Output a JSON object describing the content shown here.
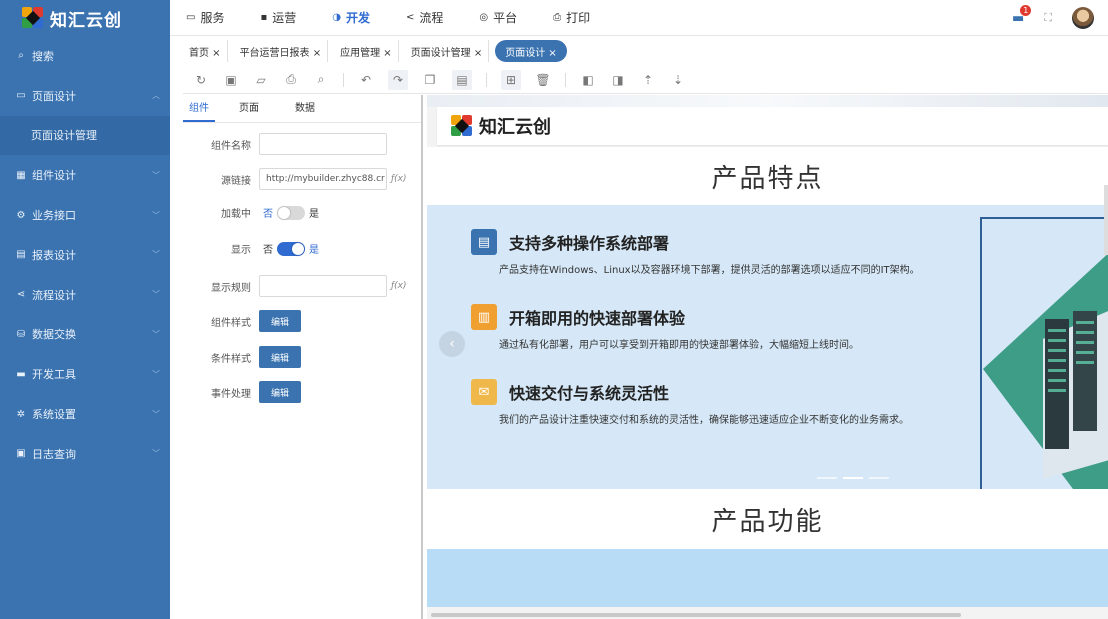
{
  "app": {
    "name": "知汇云创"
  },
  "sidebar": {
    "items": [
      {
        "label": "搜索",
        "icon": "search-icon",
        "glyph": "⌕"
      },
      {
        "label": "页面设计",
        "icon": "window-icon",
        "glyph": "▭",
        "expanded": true
      },
      {
        "label": "页面设计管理",
        "sub": true
      },
      {
        "label": "组件设计",
        "icon": "grid-icon",
        "glyph": "▦"
      },
      {
        "label": "业务接口",
        "icon": "plug-icon",
        "glyph": "⚙"
      },
      {
        "label": "报表设计",
        "icon": "clipboard-icon",
        "glyph": "▤"
      },
      {
        "label": "流程设计",
        "icon": "share-icon",
        "glyph": "⋖"
      },
      {
        "label": "数据交换",
        "icon": "database-icon",
        "glyph": "⛁"
      },
      {
        "label": "开发工具",
        "icon": "toolbox-icon",
        "glyph": "▬"
      },
      {
        "label": "系统设置",
        "icon": "gear-icon",
        "glyph": "✲"
      },
      {
        "label": "日志查询",
        "icon": "log-icon",
        "glyph": "▣"
      }
    ]
  },
  "topnav": {
    "items": [
      {
        "label": "服务",
        "glyph": "▭"
      },
      {
        "label": "运营",
        "glyph": "▪"
      },
      {
        "label": "开发",
        "glyph": "◑",
        "active": true
      },
      {
        "label": "流程",
        "glyph": "<"
      },
      {
        "label": "平台",
        "glyph": "◎"
      },
      {
        "label": "打印",
        "glyph": "⎙"
      }
    ],
    "notification_count": "1"
  },
  "tabs": [
    {
      "label": "首页 ×"
    },
    {
      "label": "平台运营日报表 ×"
    },
    {
      "label": "应用管理 ×"
    },
    {
      "label": "页面设计管理 ×"
    },
    {
      "label": "页面设计 ×",
      "active": true
    }
  ],
  "panel": {
    "tabs": [
      "组件",
      "页面",
      "数据"
    ],
    "fields": {
      "name_label": "组件名称",
      "name_value": "",
      "link_label": "源链接",
      "link_value": "http://mybuilder.zhyc88.cr",
      "fx": "ƒ(x)",
      "loading_label": "加载中",
      "loading_no": "否",
      "loading_yes": "是",
      "loading_on": false,
      "show_label": "显示",
      "show_no": "否",
      "show_yes": "是",
      "show_on": true,
      "rule_label": "显示规则",
      "rule_value": "",
      "style_label": "组件样式",
      "cond_label": "条件样式",
      "event_label": "事件处理",
      "edit": "编辑"
    }
  },
  "canvas": {
    "brand": "知汇云创",
    "section1_title": "产品特点",
    "features": [
      {
        "title": "支持多种操作系统部署",
        "desc": "产品支持在Windows、Linux以及容器环境下部署，提供灵活的部署选项以适应不同的IT架构。",
        "color": "#3a73b0",
        "icon": "chat-icon",
        "glyph": "▤"
      },
      {
        "title": "开箱即用的快速部署体验",
        "desc": "通过私有化部署，用户可以享受到开箱即用的快速部署体验，大幅缩短上线时间。",
        "color": "#f0a030",
        "icon": "document-icon",
        "glyph": "▥"
      },
      {
        "title": "快速交付与系统灵活性",
        "desc": "我们的产品设计注重快速交付和系统的灵活性，确保能够迅速适应企业不断变化的业务需求。",
        "color": "#f0b84a",
        "icon": "mail-icon",
        "glyph": "✉"
      }
    ],
    "section2_title": "产品功能"
  }
}
